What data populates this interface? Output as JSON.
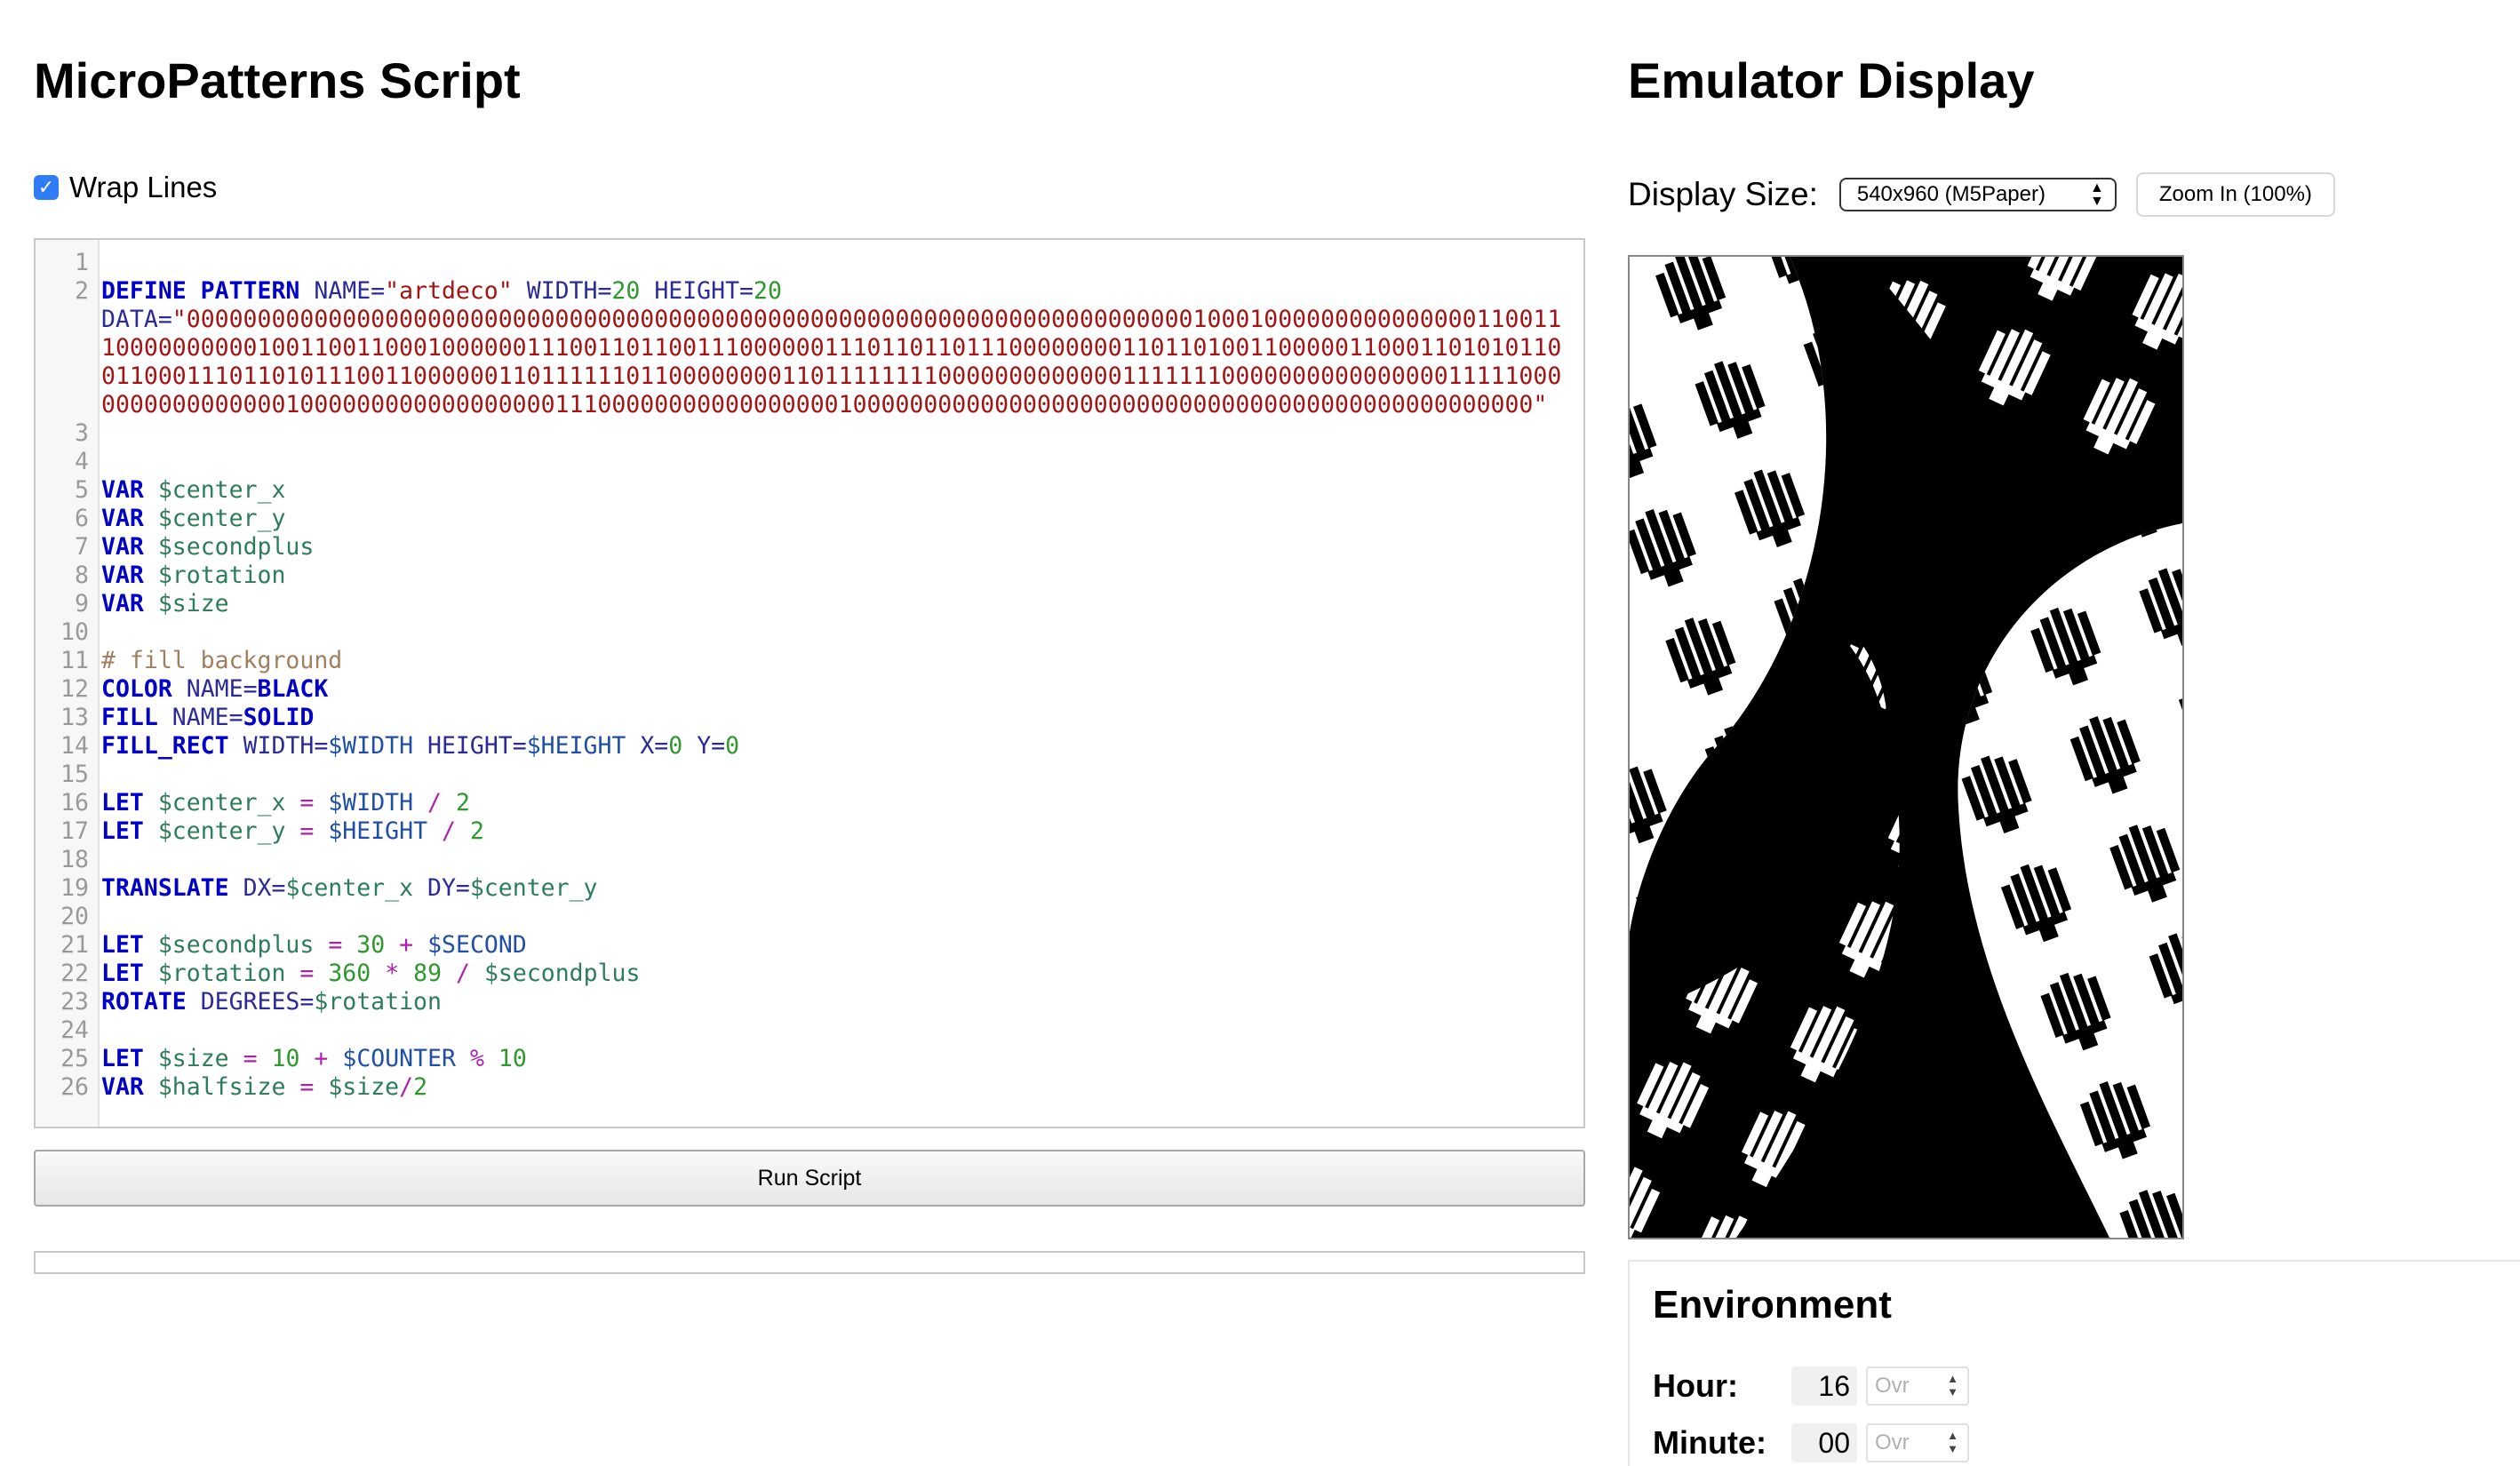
{
  "script_panel": {
    "title": "MicroPatterns Script",
    "wrap_lines_label": "Wrap Lines",
    "wrap_lines_checked": true,
    "run_button_label": "Run Script"
  },
  "code_lines": [
    {
      "n": "1",
      "html": ""
    },
    {
      "n": "2",
      "html": "<span class=\"kw\">DEFINE PATTERN</span> <span class=\"attr\">NAME=</span><span class=\"str\">\"artdeco\"</span> <span class=\"attr\">WIDTH=</span><span class=\"num\">20</span> <span class=\"attr\">HEIGHT=</span><span class=\"num\">20</span>\n<span class=\"attr\">DATA=</span><span class=\"str\">\"00000000000000000000000000000000000000000000000000000000000000000000000100010000000000000001100111000000000010011001100010000001110011011001110000001110110110111000000001101101001100000110001101010110011000111011010111001100000011011111101100000000110111111110000000000000111111100000000000000001111100000000000000001000000000000000000111000000000000000001000000000000000000000000000000000000000000000000\"</span>"
    },
    {
      "n": "3",
      "html": ""
    },
    {
      "n": "4",
      "html": ""
    },
    {
      "n": "5",
      "html": "<span class=\"kw\">VAR</span> <span class=\"var\">$center_x</span>"
    },
    {
      "n": "6",
      "html": "<span class=\"kw\">VAR</span> <span class=\"var\">$center_y</span>"
    },
    {
      "n": "7",
      "html": "<span class=\"kw\">VAR</span> <span class=\"var\">$secondplus</span>"
    },
    {
      "n": "8",
      "html": "<span class=\"kw\">VAR</span> <span class=\"var\">$rotation</span>"
    },
    {
      "n": "9",
      "html": "<span class=\"kw\">VAR</span> <span class=\"var\">$size</span>"
    },
    {
      "n": "10",
      "html": ""
    },
    {
      "n": "11",
      "html": "<span class=\"cm\"># fill background</span>"
    },
    {
      "n": "12",
      "html": "<span class=\"kw\">COLOR</span> <span class=\"attr\">NAME=</span><span class=\"kw\">BLACK</span>"
    },
    {
      "n": "13",
      "html": "<span class=\"kw\">FILL</span> <span class=\"attr\">NAME=</span><span class=\"kw\">SOLID</span>"
    },
    {
      "n": "14",
      "html": "<span class=\"kw\">FILL_RECT</span> <span class=\"attr\">WIDTH=</span><span class=\"envv\">$WIDTH</span> <span class=\"attr\">HEIGHT=</span><span class=\"envv\">$HEIGHT</span> <span class=\"attr\">X=</span><span class=\"num\">0</span> <span class=\"attr\">Y=</span><span class=\"num\">0</span>"
    },
    {
      "n": "15",
      "html": ""
    },
    {
      "n": "16",
      "html": "<span class=\"kw\">LET</span> <span class=\"var\">$center_x</span> <span class=\"op\">=</span> <span class=\"envv\">$WIDTH</span> <span class=\"op\">/</span> <span class=\"num\">2</span>"
    },
    {
      "n": "17",
      "html": "<span class=\"kw\">LET</span> <span class=\"var\">$center_y</span> <span class=\"op\">=</span> <span class=\"envv\">$HEIGHT</span> <span class=\"op\">/</span> <span class=\"num\">2</span>"
    },
    {
      "n": "18",
      "html": ""
    },
    {
      "n": "19",
      "html": "<span class=\"kw\">TRANSLATE</span> <span class=\"attr\">DX=</span><span class=\"var\">$center_x</span> <span class=\"attr\">DY=</span><span class=\"var\">$center_y</span>"
    },
    {
      "n": "20",
      "html": ""
    },
    {
      "n": "21",
      "html": "<span class=\"kw\">LET</span> <span class=\"var\">$secondplus</span> <span class=\"op\">=</span> <span class=\"num\">30</span> <span class=\"op\">+</span> <span class=\"envv\">$SECOND</span>"
    },
    {
      "n": "22",
      "html": "<span class=\"kw\">LET</span> <span class=\"var\">$rotation</span> <span class=\"op\">=</span> <span class=\"num\">360</span> <span class=\"op\">*</span> <span class=\"num\">89</span> <span class=\"op\">/</span> <span class=\"var\">$secondplus</span>"
    },
    {
      "n": "23",
      "html": "<span class=\"kw\">ROTATE</span> <span class=\"attr\">DEGREES=</span><span class=\"var\">$rotation</span>"
    },
    {
      "n": "24",
      "html": ""
    },
    {
      "n": "25",
      "html": "<span class=\"kw\">LET</span> <span class=\"var\">$size</span> <span class=\"op\">=</span> <span class=\"num\">10</span> <span class=\"op\">+</span> <span class=\"envv\">$COUNTER</span> <span class=\"op\">%</span> <span class=\"num\">10</span>"
    },
    {
      "n": "26",
      "html": "<span class=\"kw\">VAR</span> <span class=\"var\">$halfsize</span> <span class=\"op\">=</span> <span class=\"var\">$size</span><span class=\"op\">/</span><span class=\"num\">2</span>"
    }
  ],
  "emulator": {
    "title": "Emulator Display",
    "display_size_label": "Display Size:",
    "display_size_value": "540x960 (M5Paper)",
    "zoom_button_label": "Zoom In (100%)"
  },
  "environment": {
    "title": "Environment",
    "fields": [
      {
        "label": "Hour:",
        "value": "16",
        "override_placeholder": "Ovr"
      },
      {
        "label": "Minute:",
        "value": "00",
        "override_placeholder": "Ovr"
      }
    ]
  },
  "colors": {
    "checkbox_accent": "#2f7cf6",
    "keyword": "#0000c8",
    "number": "#2e9a2e",
    "string": "#a31515",
    "variable": "#2e7d5a",
    "comment": "#a08060"
  }
}
